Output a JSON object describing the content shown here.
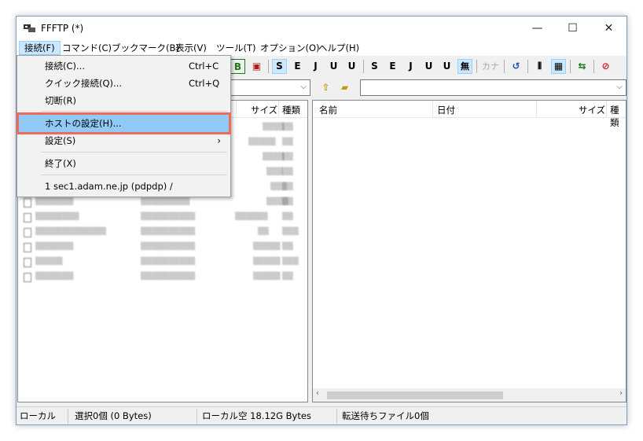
{
  "window": {
    "title": "FFFTP (*)"
  },
  "menu": [
    {
      "label": "接続(F)"
    },
    {
      "label": "コマンド(C)"
    },
    {
      "label": "ブックマーク(B)"
    },
    {
      "label": "表示(V)"
    },
    {
      "label": "ツール(T)"
    },
    {
      "label": "オプション(O)"
    },
    {
      "label": "ヘルプ(H)"
    }
  ],
  "dropdown": {
    "items": [
      {
        "label": "接続(C)...",
        "shortcut": "Ctrl+C"
      },
      {
        "label": "クイック接続(Q)...",
        "shortcut": "Ctrl+Q"
      },
      {
        "label": "切断(R)"
      },
      {
        "label": "ホストの設定(H)..."
      },
      {
        "label": "設定(S)",
        "submenu": "›"
      },
      {
        "label": "終了(X)"
      },
      {
        "label": "1 sec1.adam.ne.jp (pdpdp) /"
      }
    ]
  },
  "toolbar": {
    "buttons": [
      {
        "label": "B",
        "icon": "binary-mode-icon"
      },
      {
        "label": "S",
        "icon": "sjis-icon"
      },
      {
        "label": "E",
        "icon": "euc-icon"
      },
      {
        "label": "J",
        "icon": "jis-icon"
      },
      {
        "label": "U",
        "icon": "utf8-icon"
      },
      {
        "label": "U",
        "icon": "utf8-bom-icon"
      },
      {
        "label": "S",
        "icon": "remote-sjis-icon"
      },
      {
        "label": "E",
        "icon": "remote-euc-icon"
      },
      {
        "label": "J",
        "icon": "remote-jis-icon"
      },
      {
        "label": "U",
        "icon": "remote-utf8-icon"
      },
      {
        "label": "U",
        "icon": "remote-utf8-bom-icon"
      },
      {
        "label": "無",
        "icon": "no-conversion-icon"
      },
      {
        "label": "カナ",
        "icon": "kana-icon"
      },
      {
        "label": "↺",
        "icon": "refresh-icon"
      },
      {
        "label": "⦀",
        "icon": "list-view-icon"
      },
      {
        "label": "▦",
        "icon": "detail-view-icon"
      },
      {
        "label": "⇆",
        "icon": "sync-icon"
      },
      {
        "label": "⊘",
        "icon": "stop-icon"
      }
    ]
  },
  "local_pane": {
    "columns": {
      "size": "サイズ",
      "type": "種類"
    }
  },
  "remote_pane": {
    "columns": {
      "name": "名前",
      "date": "日付",
      "size": "サイズ",
      "type": "種類"
    }
  },
  "statusbar": {
    "location": "ローカル",
    "selection": "選択0個 (0 Bytes)",
    "free_space": "ローカル空 18.12G Bytes",
    "queue": "転送待ちファイル0個"
  },
  "colors": {
    "highlight": "#91c9f7",
    "highlight_outline": "#ef6a5a",
    "menu_open": "#cce8ff"
  }
}
